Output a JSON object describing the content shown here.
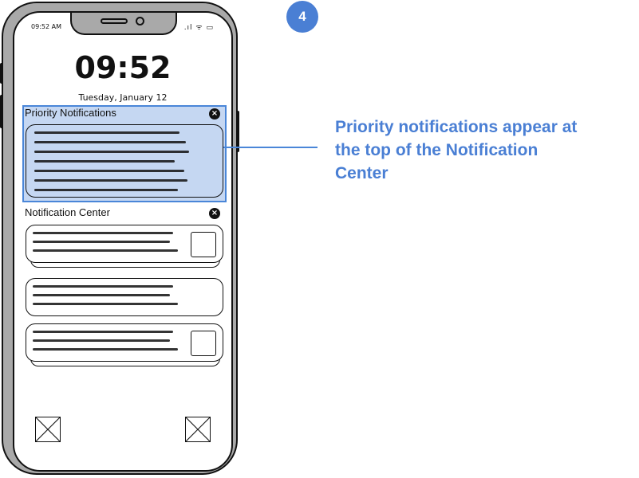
{
  "status_bar": {
    "time": "09:52 AM",
    "icons": ".ıl ᯤ ▭"
  },
  "lock_screen": {
    "clock": "09:52",
    "date": "Tuesday, January 12"
  },
  "priority": {
    "title": "Priority Notifications",
    "close": "×"
  },
  "center": {
    "title": "Notification Center",
    "close": "×"
  },
  "annotation": {
    "step": "4",
    "text": "Priority notifications appear at the top of the Notification Center",
    "accent_color": "#4a7fd4"
  }
}
